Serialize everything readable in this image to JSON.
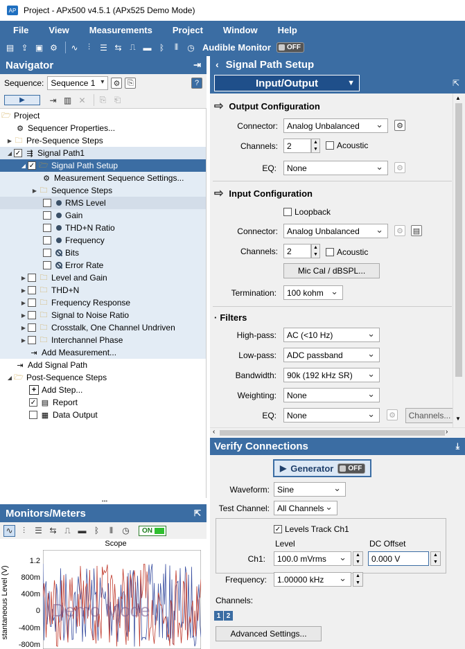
{
  "titlebar": {
    "logo": "AP",
    "title": "Project - APx500 v4.5.1 (APx525 Demo Mode)"
  },
  "menu": [
    "File",
    "View",
    "Measurements",
    "Project",
    "Window",
    "Help"
  ],
  "toolbar": {
    "audible_label": "Audible Monitor",
    "audible_state": "OFF"
  },
  "navigator": {
    "title": "Navigator",
    "sequence_label": "Sequence:",
    "sequence_value": "Sequence 1",
    "tree": [
      {
        "label": "Project"
      },
      {
        "label": "Sequencer Properties..."
      },
      {
        "label": "Pre-Sequence Steps"
      },
      {
        "label": "Signal Path1"
      },
      {
        "label": "Signal Path Setup"
      },
      {
        "label": "Measurement Sequence Settings..."
      },
      {
        "label": "Sequence Steps"
      },
      {
        "label": "RMS Level"
      },
      {
        "label": "Gain"
      },
      {
        "label": "THD+N Ratio"
      },
      {
        "label": "Frequency"
      },
      {
        "label": "Bits"
      },
      {
        "label": "Error Rate"
      },
      {
        "label": "Level and Gain"
      },
      {
        "label": "THD+N"
      },
      {
        "label": "Frequency Response"
      },
      {
        "label": "Signal to Noise Ratio"
      },
      {
        "label": "Crosstalk, One Channel Undriven"
      },
      {
        "label": "Interchannel Phase"
      },
      {
        "label": "Add Measurement..."
      },
      {
        "label": "Add Signal Path"
      },
      {
        "label": "Post-Sequence Steps"
      },
      {
        "label": "Add Step..."
      },
      {
        "label": "Report"
      },
      {
        "label": "Data Output"
      }
    ]
  },
  "monitors": {
    "title": "Monitors/Meters",
    "on_label": "ON",
    "scope_title": "Scope",
    "ylabel": "stantaneous Level (V)",
    "yticks": [
      "1.2",
      "800m",
      "400m",
      "0",
      "-400m",
      "-800m"
    ],
    "watermark": "Demo Mode"
  },
  "signal_path": {
    "title": "Signal Path Setup",
    "tab": "Input/Output",
    "output": {
      "title": "Output Configuration",
      "connector_label": "Connector:",
      "connector": "Analog Unbalanced",
      "channels_label": "Channels:",
      "channels": "2",
      "acoustic": "Acoustic",
      "eq_label": "EQ:",
      "eq": "None"
    },
    "input": {
      "title": "Input Configuration",
      "loopback": "Loopback",
      "connector_label": "Connector:",
      "connector": "Analog Unbalanced",
      "channels_label": "Channels:",
      "channels": "2",
      "acoustic": "Acoustic",
      "mic_cal": "Mic Cal / dBSPL...",
      "termination_label": "Termination:",
      "termination": "100 kohm"
    },
    "filters": {
      "title": "Filters",
      "highpass_label": "High-pass:",
      "highpass": "AC (<10 Hz)",
      "lowpass_label": "Low-pass:",
      "lowpass": "ADC passband",
      "bandwidth_label": "Bandwidth:",
      "bandwidth": "90k (192 kHz SR)",
      "weighting_label": "Weighting:",
      "weighting": "None",
      "eq_label": "EQ:",
      "eq": "None",
      "channels_btn": "Channels..."
    }
  },
  "verify": {
    "title": "Verify Connections",
    "generator": "Generator",
    "generator_state": "OFF",
    "waveform_label": "Waveform:",
    "waveform": "Sine",
    "test_channel_label": "Test Channel:",
    "test_channel": "All Channels",
    "levels_track": "Levels Track Ch1",
    "level_header": "Level",
    "dc_header": "DC Offset",
    "ch1_label": "Ch1:",
    "level": "100.0 mVrms",
    "dc_offset": "0.000 V",
    "frequency_label": "Frequency:",
    "frequency": "1.00000 kHz",
    "channels_label": "Channels:",
    "ch_buttons": [
      "1",
      "2"
    ],
    "advanced": "Advanced Settings..."
  },
  "colors": {
    "accent": "#3b6da3",
    "selection": "#3b6da3",
    "series1": "#c0392b",
    "series2": "#3a4fa0"
  }
}
